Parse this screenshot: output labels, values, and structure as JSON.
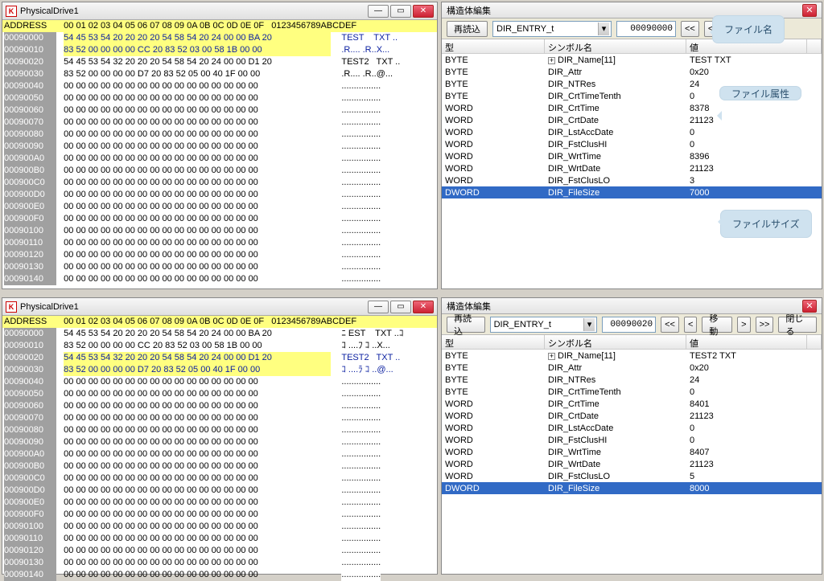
{
  "hex1": {
    "title": "PhysicalDrive1",
    "header_addr": "ADDRESS",
    "header_cols": "00 01 02 03 04 05 06 07 08 09 0A 0B 0C 0D 0E 0F",
    "header_ascii": "0123456789ABCDEF",
    "lines": [
      {
        "addr": "00090000",
        "bytes": "54 45 53 54 20 20 20 20 54 58 54 20 24 00 00 BA 20",
        "ascii": "TEST    TXT ..",
        "hl": true,
        "blue": true
      },
      {
        "addr": "00090010",
        "bytes": "83 52 00 00 00 00 CC 20 83 52 03 00 58 1B 00 00",
        "ascii": ".R.... .R..X...",
        "hl": true,
        "blue": true
      },
      {
        "addr": "00090020",
        "bytes": "54 45 53 54 32 20 20 20 54 58 54 20 24 00 00 D1 20",
        "ascii": "TEST2   TXT ..",
        "hl": false,
        "blue": false
      },
      {
        "addr": "00090030",
        "bytes": "83 52 00 00 00 00 D7 20 83 52 05 00 40 1F 00 00",
        "ascii": ".R.... .R..@...",
        "hl": false,
        "blue": false
      },
      {
        "addr": "00090040",
        "bytes": "00 00 00 00 00 00 00 00 00 00 00 00 00 00 00 00",
        "ascii": "................",
        "hl": false,
        "blue": false
      },
      {
        "addr": "00090050",
        "bytes": "00 00 00 00 00 00 00 00 00 00 00 00 00 00 00 00",
        "ascii": "................",
        "hl": false,
        "blue": false
      },
      {
        "addr": "00090060",
        "bytes": "00 00 00 00 00 00 00 00 00 00 00 00 00 00 00 00",
        "ascii": "................",
        "hl": false,
        "blue": false
      },
      {
        "addr": "00090070",
        "bytes": "00 00 00 00 00 00 00 00 00 00 00 00 00 00 00 00",
        "ascii": "................",
        "hl": false,
        "blue": false
      },
      {
        "addr": "00090080",
        "bytes": "00 00 00 00 00 00 00 00 00 00 00 00 00 00 00 00",
        "ascii": "................",
        "hl": false,
        "blue": false
      },
      {
        "addr": "00090090",
        "bytes": "00 00 00 00 00 00 00 00 00 00 00 00 00 00 00 00",
        "ascii": "................",
        "hl": false,
        "blue": false
      },
      {
        "addr": "000900A0",
        "bytes": "00 00 00 00 00 00 00 00 00 00 00 00 00 00 00 00",
        "ascii": "................",
        "hl": false,
        "blue": false
      },
      {
        "addr": "000900B0",
        "bytes": "00 00 00 00 00 00 00 00 00 00 00 00 00 00 00 00",
        "ascii": "................",
        "hl": false,
        "blue": false
      },
      {
        "addr": "000900C0",
        "bytes": "00 00 00 00 00 00 00 00 00 00 00 00 00 00 00 00",
        "ascii": "................",
        "hl": false,
        "blue": false
      },
      {
        "addr": "000900D0",
        "bytes": "00 00 00 00 00 00 00 00 00 00 00 00 00 00 00 00",
        "ascii": "................",
        "hl": false,
        "blue": false
      },
      {
        "addr": "000900E0",
        "bytes": "00 00 00 00 00 00 00 00 00 00 00 00 00 00 00 00",
        "ascii": "................",
        "hl": false,
        "blue": false
      },
      {
        "addr": "000900F0",
        "bytes": "00 00 00 00 00 00 00 00 00 00 00 00 00 00 00 00",
        "ascii": "................",
        "hl": false,
        "blue": false
      },
      {
        "addr": "00090100",
        "bytes": "00 00 00 00 00 00 00 00 00 00 00 00 00 00 00 00",
        "ascii": "................",
        "hl": false,
        "blue": false
      },
      {
        "addr": "00090110",
        "bytes": "00 00 00 00 00 00 00 00 00 00 00 00 00 00 00 00",
        "ascii": "................",
        "hl": false,
        "blue": false
      },
      {
        "addr": "00090120",
        "bytes": "00 00 00 00 00 00 00 00 00 00 00 00 00 00 00 00",
        "ascii": "................",
        "hl": false,
        "blue": false
      },
      {
        "addr": "00090130",
        "bytes": "00 00 00 00 00 00 00 00 00 00 00 00 00 00 00 00",
        "ascii": "................",
        "hl": false,
        "blue": false
      },
      {
        "addr": "00090140",
        "bytes": "00 00 00 00 00 00 00 00 00 00 00 00 00 00 00 00",
        "ascii": "................",
        "hl": false,
        "blue": false
      }
    ]
  },
  "hex2": {
    "title": "PhysicalDrive1",
    "lines": [
      {
        "addr": "00090000",
        "bytes": "54 45 53 54 20 20 20 20 54 58 54 20 24 00 00 BA 20",
        "ascii": "ﾆ EST    TXT ..ｺ",
        "hl": false,
        "blue": false
      },
      {
        "addr": "00090010",
        "bytes": "83 52 00 00 00 00 CC 20 83 52 03 00 58 1B 00 00",
        "ascii": "ｺ ....ﾌ ｺ ..X...",
        "hl": false,
        "blue": false
      },
      {
        "addr": "00090020",
        "bytes": "54 45 53 54 32 20 20 20 54 58 54 20 24 00 00 D1 20",
        "ascii": "TEST2   TXT ..",
        "hl": true,
        "blue": true
      },
      {
        "addr": "00090030",
        "bytes": "83 52 00 00 00 00 D7 20 83 52 05 00 40 1F 00 00",
        "ascii": "ｺ ....ﾗ ｺ ..@...",
        "hl": true,
        "blue": true
      },
      {
        "addr": "00090040",
        "bytes": "00 00 00 00 00 00 00 00 00 00 00 00 00 00 00 00",
        "ascii": "................",
        "hl": false,
        "blue": false
      },
      {
        "addr": "00090050",
        "bytes": "00 00 00 00 00 00 00 00 00 00 00 00 00 00 00 00",
        "ascii": "................",
        "hl": false,
        "blue": false
      },
      {
        "addr": "00090060",
        "bytes": "00 00 00 00 00 00 00 00 00 00 00 00 00 00 00 00",
        "ascii": "................",
        "hl": false,
        "blue": false
      },
      {
        "addr": "00090070",
        "bytes": "00 00 00 00 00 00 00 00 00 00 00 00 00 00 00 00",
        "ascii": "................",
        "hl": false,
        "blue": false
      },
      {
        "addr": "00090080",
        "bytes": "00 00 00 00 00 00 00 00 00 00 00 00 00 00 00 00",
        "ascii": "................",
        "hl": false,
        "blue": false
      },
      {
        "addr": "00090090",
        "bytes": "00 00 00 00 00 00 00 00 00 00 00 00 00 00 00 00",
        "ascii": "................",
        "hl": false,
        "blue": false
      },
      {
        "addr": "000900A0",
        "bytes": "00 00 00 00 00 00 00 00 00 00 00 00 00 00 00 00",
        "ascii": "................",
        "hl": false,
        "blue": false
      },
      {
        "addr": "000900B0",
        "bytes": "00 00 00 00 00 00 00 00 00 00 00 00 00 00 00 00",
        "ascii": "................",
        "hl": false,
        "blue": false
      },
      {
        "addr": "000900C0",
        "bytes": "00 00 00 00 00 00 00 00 00 00 00 00 00 00 00 00",
        "ascii": "................",
        "hl": false,
        "blue": false
      },
      {
        "addr": "000900D0",
        "bytes": "00 00 00 00 00 00 00 00 00 00 00 00 00 00 00 00",
        "ascii": "................",
        "hl": false,
        "blue": false
      },
      {
        "addr": "000900E0",
        "bytes": "00 00 00 00 00 00 00 00 00 00 00 00 00 00 00 00",
        "ascii": "................",
        "hl": false,
        "blue": false
      },
      {
        "addr": "000900F0",
        "bytes": "00 00 00 00 00 00 00 00 00 00 00 00 00 00 00 00",
        "ascii": "................",
        "hl": false,
        "blue": false
      },
      {
        "addr": "00090100",
        "bytes": "00 00 00 00 00 00 00 00 00 00 00 00 00 00 00 00",
        "ascii": "................",
        "hl": false,
        "blue": false
      },
      {
        "addr": "00090110",
        "bytes": "00 00 00 00 00 00 00 00 00 00 00 00 00 00 00 00",
        "ascii": "................",
        "hl": false,
        "blue": false
      },
      {
        "addr": "00090120",
        "bytes": "00 00 00 00 00 00 00 00 00 00 00 00 00 00 00 00",
        "ascii": "................",
        "hl": false,
        "blue": false
      },
      {
        "addr": "00090130",
        "bytes": "00 00 00 00 00 00 00 00 00 00 00 00 00 00 00 00",
        "ascii": "................",
        "hl": false,
        "blue": false
      },
      {
        "addr": "00090140",
        "bytes": "00 00 00 00 00 00 00 00 00 00 00 00 00 00 00 00",
        "ascii": "................",
        "hl": false,
        "blue": false
      }
    ]
  },
  "struct1": {
    "title": "構造体編集",
    "reload": "再読込",
    "combo": "DIR_ENTRY_t",
    "addr": "00090000",
    "prev2": "<<",
    "prev1": "<",
    "col_type": "型",
    "col_sym": "シンボル名",
    "col_val": "値",
    "rows": [
      {
        "type": "BYTE",
        "sym": "DIR_Name[11]",
        "val": "TEST    TXT",
        "expand": true
      },
      {
        "type": "BYTE",
        "sym": "DIR_Attr",
        "val": "0x20"
      },
      {
        "type": "BYTE",
        "sym": "DIR_NTRes",
        "val": "24"
      },
      {
        "type": "BYTE",
        "sym": "DIR_CrtTimeTenth",
        "val": "0"
      },
      {
        "type": "WORD",
        "sym": "DIR_CrtTime",
        "val": "8378"
      },
      {
        "type": "WORD",
        "sym": "DIR_CrtDate",
        "val": "21123"
      },
      {
        "type": "WORD",
        "sym": "DIR_LstAccDate",
        "val": "0"
      },
      {
        "type": "WORD",
        "sym": "DIR_FstClusHI",
        "val": "0"
      },
      {
        "type": "WORD",
        "sym": "DIR_WrtTime",
        "val": "8396"
      },
      {
        "type": "WORD",
        "sym": "DIR_WrtDate",
        "val": "21123"
      },
      {
        "type": "WORD",
        "sym": "DIR_FstClusLO",
        "val": "3"
      },
      {
        "type": "DWORD",
        "sym": "DIR_FileSize",
        "val": "7000",
        "sel": true
      }
    ]
  },
  "struct2": {
    "title": "構造体編集",
    "reload": "再読込",
    "combo": "DIR_ENTRY_t",
    "addr": "00090020",
    "prev2": "<<",
    "prev1": "<",
    "move": "移動",
    "next1": ">",
    "next2": ">>",
    "close": "閉じる",
    "rows": [
      {
        "type": "BYTE",
        "sym": "DIR_Name[11]",
        "val": "TEST2   TXT",
        "expand": true
      },
      {
        "type": "BYTE",
        "sym": "DIR_Attr",
        "val": "0x20"
      },
      {
        "type": "BYTE",
        "sym": "DIR_NTRes",
        "val": "24"
      },
      {
        "type": "BYTE",
        "sym": "DIR_CrtTimeTenth",
        "val": "0"
      },
      {
        "type": "WORD",
        "sym": "DIR_CrtTime",
        "val": "8401"
      },
      {
        "type": "WORD",
        "sym": "DIR_CrtDate",
        "val": "21123"
      },
      {
        "type": "WORD",
        "sym": "DIR_LstAccDate",
        "val": "0"
      },
      {
        "type": "WORD",
        "sym": "DIR_FstClusHI",
        "val": "0"
      },
      {
        "type": "WORD",
        "sym": "DIR_WrtTime",
        "val": "8407"
      },
      {
        "type": "WORD",
        "sym": "DIR_WrtDate",
        "val": "21123"
      },
      {
        "type": "WORD",
        "sym": "DIR_FstClusLO",
        "val": "5"
      },
      {
        "type": "DWORD",
        "sym": "DIR_FileSize",
        "val": "8000",
        "sel": true
      }
    ]
  },
  "callouts": {
    "filename": "ファイル名",
    "fileattr": "ファイル属性",
    "filesize": "ファイルサイズ"
  }
}
